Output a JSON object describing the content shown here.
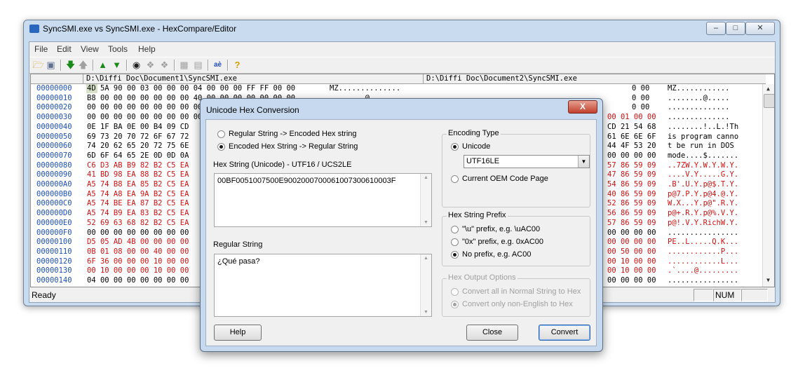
{
  "main_window": {
    "title": "SyncSMI.exe vs SyncSMI.exe - HexCompare/Editor",
    "controls": [
      "minimize",
      "maximize",
      "close"
    ]
  },
  "menu": [
    "File",
    "Edit",
    "View",
    "Tools",
    "Help"
  ],
  "toolbar_icons": [
    "open-folder-icon",
    "save-icon",
    "arrow-down-green-icon",
    "arrow-up-gray-icon",
    "double-arrow-up-green-icon",
    "double-arrow-down-green-icon",
    "binoculars-icon",
    "find-next-icon",
    "find-prev-icon",
    "grid-icon",
    "grid-alt-icon",
    "hex-convert-icon",
    "help-question-icon"
  ],
  "panes": {
    "left_path": "D:\\Diffi Doc\\Document1\\SyncSMI.exe",
    "right_path": "D:\\Diffi Doc\\Document2\\SyncSMI.exe"
  },
  "rows": [
    {
      "offset": "00000000",
      "hex": "4D 5A 90 00 03 00 00 00 04 00 00 00 FF FF 00 00",
      "ascii": "MZ..............",
      "right_tail": "0 00",
      "right_ascii": "MZ............",
      "diff": false
    },
    {
      "offset": "00000010",
      "hex": "B8 00 00 00 00 00 00 00 40 00 00 00 00 00 00 00",
      "ascii": "........@.......",
      "right_tail": "0 00",
      "right_ascii": "........@.....",
      "diff": false
    },
    {
      "offset": "00000020",
      "hex": "00 00 00 00 00 00 00 00 00 00 00 00 00 00 00 00",
      "ascii": "................",
      "right_tail": "0 00",
      "right_ascii": "..............",
      "diff": false
    },
    {
      "offset": "00000030",
      "hex": "00 00 00 00 00 00 00 00 00 00 00 00 00 01 00 00",
      "ascii": "................",
      "right_tail": "00 01 00 00",
      "right_ascii": "..............",
      "diff": false,
      "right_red": "00 01"
    },
    {
      "offset": "00000040",
      "hex": "0E 1F BA 0E 00 B4 09 CD",
      "ascii": "",
      "right_tail": "CD 21 54 68",
      "right_ascii": "........!..L.!Th",
      "diff": false
    },
    {
      "offset": "00000050",
      "hex": "69 73 20 70 72 6F 67 72",
      "ascii": "",
      "right_tail": "61 6E 6E 6F",
      "right_ascii": "is program canno",
      "diff": false
    },
    {
      "offset": "00000060",
      "hex": "74 20 62 65 20 72 75 6E",
      "ascii": "",
      "right_tail": "44 4F 53 20",
      "right_ascii": "t be run in DOS ",
      "diff": false
    },
    {
      "offset": "00000070",
      "hex": "6D 6F 64 65 2E 0D 0D 0A",
      "ascii": "",
      "right_tail": "00 00 00 00",
      "right_ascii": "mode....$.......",
      "diff": false
    },
    {
      "offset": "00000080",
      "hex": "C6 D3 AB B9 82 B2 C5 EA",
      "ascii": "",
      "right_tail": "57 86 59 09",
      "right_ascii": "..7ZW.Y.W.Y.W.Y.",
      "diff": true
    },
    {
      "offset": "00000090",
      "hex": "41 BD 98 EA 88 B2 C5 EA",
      "ascii": "",
      "right_tail": "47 86 59 09",
      "right_ascii": "....V.Y.....G.Y.",
      "diff": true
    },
    {
      "offset": "000000A0",
      "hex": "A5 74 B8 EA 85 B2 C5 EA",
      "ascii": "",
      "right_tail": "54 86 59 09",
      "right_ascii": ".B'.U.Y.p@$.T.Y.",
      "diff": true
    },
    {
      "offset": "000000B0",
      "hex": "A5 74 A8 EA 9A B2 C5 EA",
      "ascii": "",
      "right_tail": "40 86 59 09",
      "right_ascii": "p@7.P.Y.p@4.@.Y.",
      "diff": true
    },
    {
      "offset": "000000C0",
      "hex": "A5 74 BE EA 87 B2 C5 EA",
      "ascii": "",
      "right_tail": "52 86 59 09",
      "right_ascii": "W.X...Y.p@\".R.Y.",
      "diff": true
    },
    {
      "offset": "000000D0",
      "hex": "A5 74 B9 EA 83 B2 C5 EA",
      "ascii": "",
      "right_tail": "56 86 59 09",
      "right_ascii": "p@+.R.Y.p@%.V.Y.",
      "diff": true
    },
    {
      "offset": "000000E0",
      "hex": "52 69 63 68 82 B2 C5 EA",
      "ascii": "",
      "right_tail": "57 86 59 09",
      "right_ascii": "p@!.V.Y.RichW.Y.",
      "diff": true
    },
    {
      "offset": "000000F0",
      "hex": "00 00 00 00 00 00 00 00",
      "ascii": "",
      "right_tail": "00 00 00 00",
      "right_ascii": "................",
      "diff": false
    },
    {
      "offset": "00000100",
      "hex": "D5 05 AD 4B 00 00 00 00",
      "ascii": "",
      "right_tail": "00 00 00 00",
      "right_ascii": "PE..L.....Q.K...",
      "diff": true
    },
    {
      "offset": "00000110",
      "hex": "0B 01 08 00 00 40 00 00",
      "ascii": "",
      "right_tail": "00 50 00 00",
      "right_ascii": "............P...",
      "diff": true
    },
    {
      "offset": "00000120",
      "hex": "6F 36 00 00 00 10 00 00",
      "ascii": "",
      "right_tail": "00 10 00 00",
      "right_ascii": "............L...",
      "diff": true
    },
    {
      "offset": "00000130",
      "hex": "00 10 00 00 00 10 00 00",
      "ascii": "",
      "right_tail": "00 10 00 00",
      "right_ascii": ".`....@.........",
      "diff": true
    },
    {
      "offset": "00000140",
      "hex": "04 00 00 00 00 00 00 00",
      "ascii": "",
      "right_tail": "00 00 00 00",
      "right_ascii": "................",
      "diff": false
    }
  ],
  "status": {
    "text": "Ready",
    "num": "NUM"
  },
  "dialog": {
    "title": "Unicode Hex Conversion",
    "close_glyph": "X",
    "direction_options": [
      {
        "label": "Regular String -> Encoded Hex string",
        "checked": false
      },
      {
        "label": "Encoded Hex String -> Regular String",
        "checked": true
      }
    ],
    "hex_label": "Hex String (Unicode) - UTF16 / UCS2LE",
    "hex_value": "00BF0051007500E9002000700061007300610003F",
    "regular_label": "Regular String",
    "regular_value": "¿Qué pasa?",
    "encoding_group": "Encoding Type",
    "encoding_unicode": "Unicode",
    "encoding_select": "UTF16LE",
    "encoding_oem": "Current OEM Code Page",
    "prefix_group": "Hex String Prefix",
    "prefix_options": [
      {
        "label": "\"\\u\" prefix, e.g. \\uAC00",
        "checked": false
      },
      {
        "label": "\"0x\" prefix, e.g. 0xAC00",
        "checked": false
      },
      {
        "label": "No prefix, e.g. AC00",
        "checked": true
      }
    ],
    "output_group": "Hex Output Options",
    "output_options": [
      {
        "label": "Convert all in Normal String to Hex",
        "checked": false
      },
      {
        "label": "Convert only non-English to Hex",
        "checked": true
      }
    ],
    "buttons": {
      "help": "Help",
      "close": "Close",
      "convert": "Convert"
    }
  }
}
